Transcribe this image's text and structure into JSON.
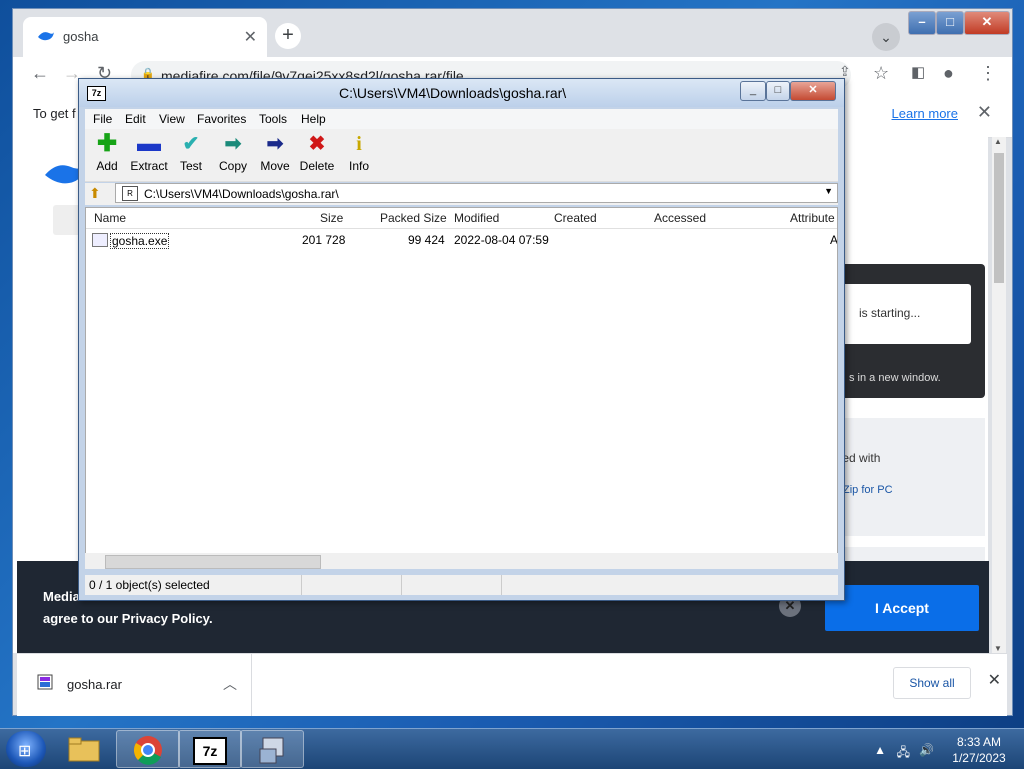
{
  "browser": {
    "tab_title": "gosha",
    "url": "mediafire.com/file/9v7qei25xx8sd2l/gosha.rar/file",
    "infobar_text": "To get f",
    "infobar_learn_more": "Learn more"
  },
  "page": {
    "download_status": "is starting...",
    "new_window_text": "s in a new window.",
    "promo_text": "ened with",
    "promo_link": "Zip for PC",
    "cookie_line1": "Media",
    "cookie_line2": "agree to our Privacy Policy.",
    "accept_label": "I Accept"
  },
  "downloads_bar": {
    "file": "gosha.rar",
    "show_all": "Show all"
  },
  "sevenzip": {
    "app_icon": "7z",
    "title": "C:\\Users\\VM4\\Downloads\\gosha.rar\\",
    "menu": [
      "File",
      "Edit",
      "View",
      "Favorites",
      "Tools",
      "Help"
    ],
    "tools": [
      {
        "label": "Add",
        "icon": "plus-icon",
        "color": "#16a316"
      },
      {
        "label": "Extract",
        "icon": "minus-icon",
        "color": "#1b38c8"
      },
      {
        "label": "Test",
        "icon": "check-icon",
        "color": "#2ab0b0"
      },
      {
        "label": "Copy",
        "icon": "copy-arrow-icon",
        "color": "#1a8a7a"
      },
      {
        "label": "Move",
        "icon": "move-arrow-icon",
        "color": "#1a2a8a"
      },
      {
        "label": "Delete",
        "icon": "delete-x-icon",
        "color": "#d01818"
      },
      {
        "label": "Info",
        "icon": "info-icon",
        "color": "#c8a800"
      }
    ],
    "address": "C:\\Users\\VM4\\Downloads\\gosha.rar\\",
    "columns": [
      "Name",
      "Size",
      "Packed Size",
      "Modified",
      "Created",
      "Accessed",
      "Attribute"
    ],
    "rows": [
      {
        "name": "gosha.exe",
        "size": "201 728",
        "packed": "99 424",
        "modified": "2022-08-04 07:59",
        "attr": "A"
      }
    ],
    "status": "0 / 1 object(s) selected"
  },
  "taskbar": {
    "time": "8:33 AM",
    "date": "1/27/2023"
  }
}
